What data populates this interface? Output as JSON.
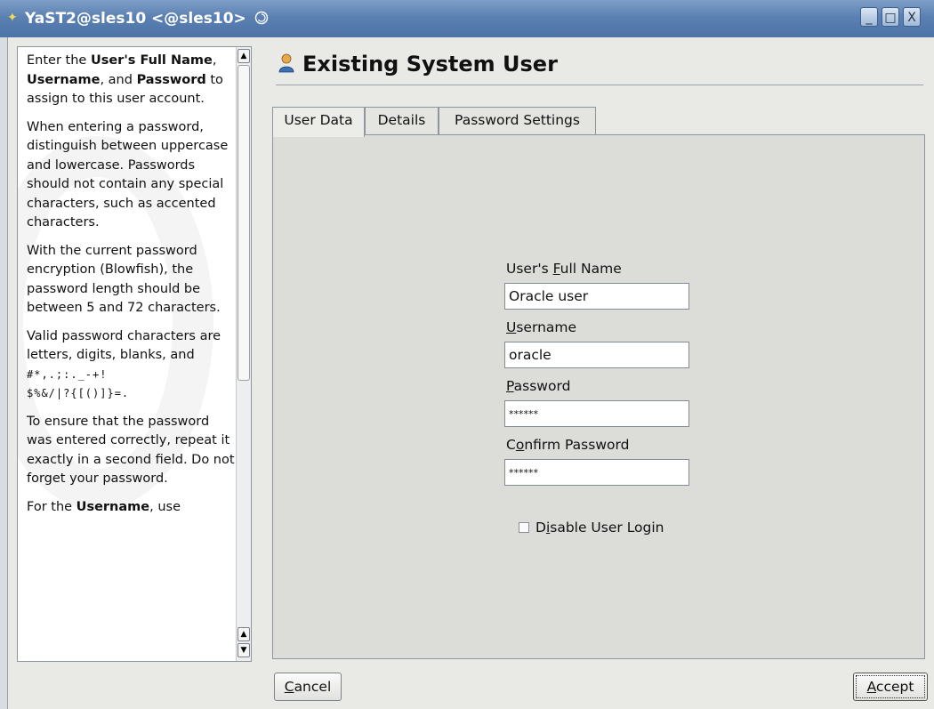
{
  "window": {
    "title": "YaST2@sles10 <@sles10>",
    "controls": [
      "_",
      "□",
      "X"
    ]
  },
  "help": {
    "p1_pre": "Enter the ",
    "p1_b1": "User's Full Name",
    "p1_mid1": ", ",
    "p1_b2": "Username",
    "p1_mid2": ", and ",
    "p1_b3": "Password",
    "p1_post": " to assign to this user account.",
    "p2": "When entering a password, distinguish between uppercase and lowercase. Passwords should not contain any special characters, such as accented characters.",
    "p3": "With the current password encryption (Blowfish), the password length should be between 5 and 72 characters.",
    "p4_text": "Valid password characters are letters, digits, blanks, and ",
    "p4_chars1": "#*,.;:._-+!",
    "p4_chars2": "$%&/|?{[()]}=.",
    "p5": "To ensure that the password was entered correctly, repeat it exactly in a second field. Do not forget your password.",
    "p6_pre": "For the ",
    "p6_b": "Username",
    "p6_post": ", use"
  },
  "dialog": {
    "title": "Existing System User",
    "tabs": [
      "User Data",
      "Details",
      "Password Settings"
    ],
    "active_tab": "User Data"
  },
  "form": {
    "full_name_label_pre": "User's ",
    "full_name_label_u": "F",
    "full_name_label_post": "ull Name",
    "full_name_value": "Oracle user",
    "username_label_u": "U",
    "username_label_post": "sername",
    "username_value": "oracle",
    "password_label_u": "P",
    "password_label_post": "assword",
    "password_value": "******",
    "confirm_label_pre": "C",
    "confirm_label_u": "o",
    "confirm_label_post": "nfirm Password",
    "confirm_value": "******",
    "disable_login_pre": "D",
    "disable_login_u": "i",
    "disable_login_post": "sable User Login",
    "disable_login_checked": false
  },
  "buttons": {
    "cancel_u": "C",
    "cancel_post": "ancel",
    "accept_u": "A",
    "accept_post": "ccept"
  },
  "colors": {
    "titlebar": "#5b80b2",
    "dialog_bg": "#e9e9e6",
    "content_bg": "#dcdcd9"
  }
}
